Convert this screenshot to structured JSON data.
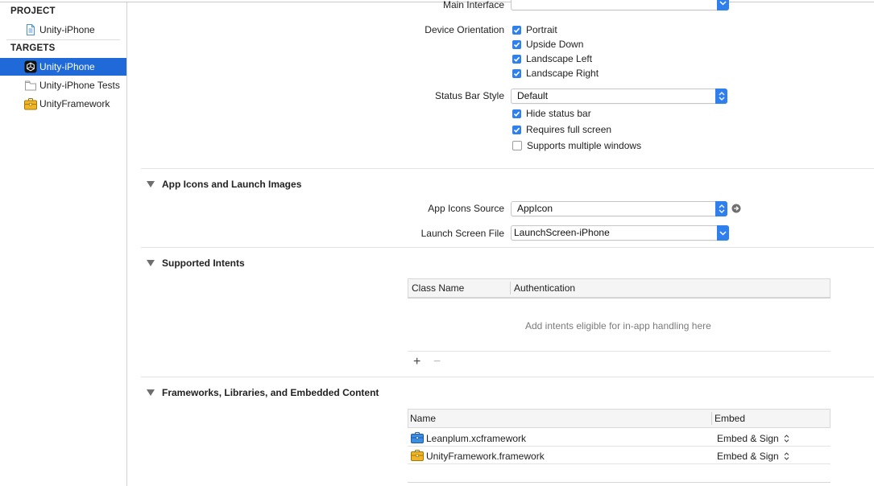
{
  "sidebar": {
    "project_header": "PROJECT",
    "project_items": [
      {
        "label": "Unity-iPhone",
        "icon": "document-icon"
      }
    ],
    "targets_header": "TARGETS",
    "target_items": [
      {
        "label": "Unity-iPhone",
        "icon": "unity-app-icon",
        "selected": true
      },
      {
        "label": "Unity-iPhone Tests",
        "icon": "test-bundle-icon",
        "selected": false
      },
      {
        "label": "UnityFramework",
        "icon": "framework-icon",
        "selected": false
      }
    ]
  },
  "deployment": {
    "main_interface_label": "Main Interface",
    "main_interface_value": "",
    "device_orientation_label": "Device Orientation",
    "orientations": [
      {
        "label": "Portrait",
        "checked": true
      },
      {
        "label": "Upside Down",
        "checked": true
      },
      {
        "label": "Landscape Left",
        "checked": true
      },
      {
        "label": "Landscape Right",
        "checked": true
      }
    ],
    "status_bar_style_label": "Status Bar Style",
    "status_bar_style_value": "Default",
    "status_options": [
      {
        "label": "Hide status bar",
        "checked": true
      },
      {
        "label": "Requires full screen",
        "checked": true
      },
      {
        "label": "Supports multiple windows",
        "checked": false
      }
    ]
  },
  "app_icons": {
    "title": "App Icons and Launch Images",
    "icons_source_label": "App Icons Source",
    "icons_source_value": "AppIcon",
    "launch_screen_label": "Launch Screen File",
    "launch_screen_value": "LaunchScreen-iPhone"
  },
  "intents": {
    "title": "Supported Intents",
    "columns": [
      "Class Name",
      "Authentication"
    ],
    "empty_text": "Add intents eligible for in-app handling here",
    "add_symbol": "+",
    "remove_symbol": "−"
  },
  "frameworks": {
    "title": "Frameworks, Libraries, and Embedded Content",
    "columns": [
      "Name",
      "Embed"
    ],
    "rows": [
      {
        "name": "Leanplum.xcframework",
        "embed": "Embed & Sign",
        "icon": "toolbox-blue-icon"
      },
      {
        "name": "UnityFramework.framework",
        "embed": "Embed & Sign",
        "icon": "toolbox-yellow-icon"
      }
    ]
  },
  "colors": {
    "accent": "#2f80ed",
    "selection": "#1f6ad8",
    "framework_yellow": "#f0b429",
    "framework_blue": "#3b8ee0"
  }
}
